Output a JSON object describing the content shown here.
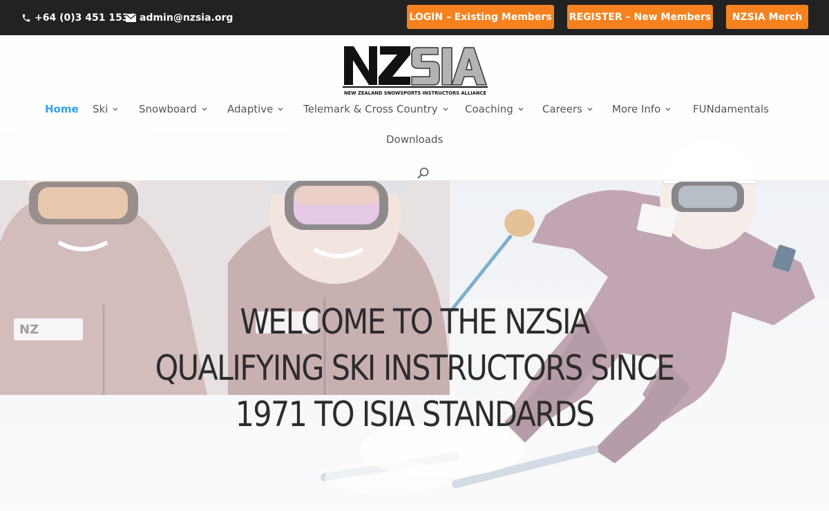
{
  "topbar": {
    "phone": "+64 (0)3 451 1534",
    "phone_icon": "phone-icon",
    "email": "admin@nzsia.org",
    "email_icon": "envelope-icon",
    "buttons": {
      "login": "LOGIN – Existing Members",
      "register": "REGISTER – New Members",
      "merch": "NZSIA Merch"
    },
    "accent_color": "#f5821f",
    "background_color": "#222222"
  },
  "header": {
    "logo": {
      "mark_left": "NZ",
      "mark_right": "SIA",
      "tagline": "NEW ZEALAND SNOWSPORTS INSTRUCTORS ALLIANCE"
    },
    "nav": [
      {
        "label": "Home",
        "active": true,
        "dropdown": false
      },
      {
        "label": "Ski",
        "active": false,
        "dropdown": true
      },
      {
        "label": "Snowboard",
        "active": false,
        "dropdown": true
      },
      {
        "label": "Adaptive",
        "active": false,
        "dropdown": true
      },
      {
        "label": "Telemark & Cross Country",
        "active": false,
        "dropdown": true
      },
      {
        "label": "Coaching",
        "active": false,
        "dropdown": true
      },
      {
        "label": "Careers",
        "active": false,
        "dropdown": true
      },
      {
        "label": "More Info",
        "active": false,
        "dropdown": true
      },
      {
        "label": "FUNdamentals",
        "active": false,
        "dropdown": false
      },
      {
        "label": "Downloads",
        "active": false,
        "dropdown": false
      }
    ],
    "active_color": "#2ea3f2",
    "search_icon": "search-icon"
  },
  "hero": {
    "title_lines": [
      "WELCOME TO THE NZSIA",
      "QUALIFYING SKI INSTRUCTORS SINCE",
      "1971 TO ISIA STANDARDS"
    ],
    "image_description": "ski-instructors-photo"
  }
}
